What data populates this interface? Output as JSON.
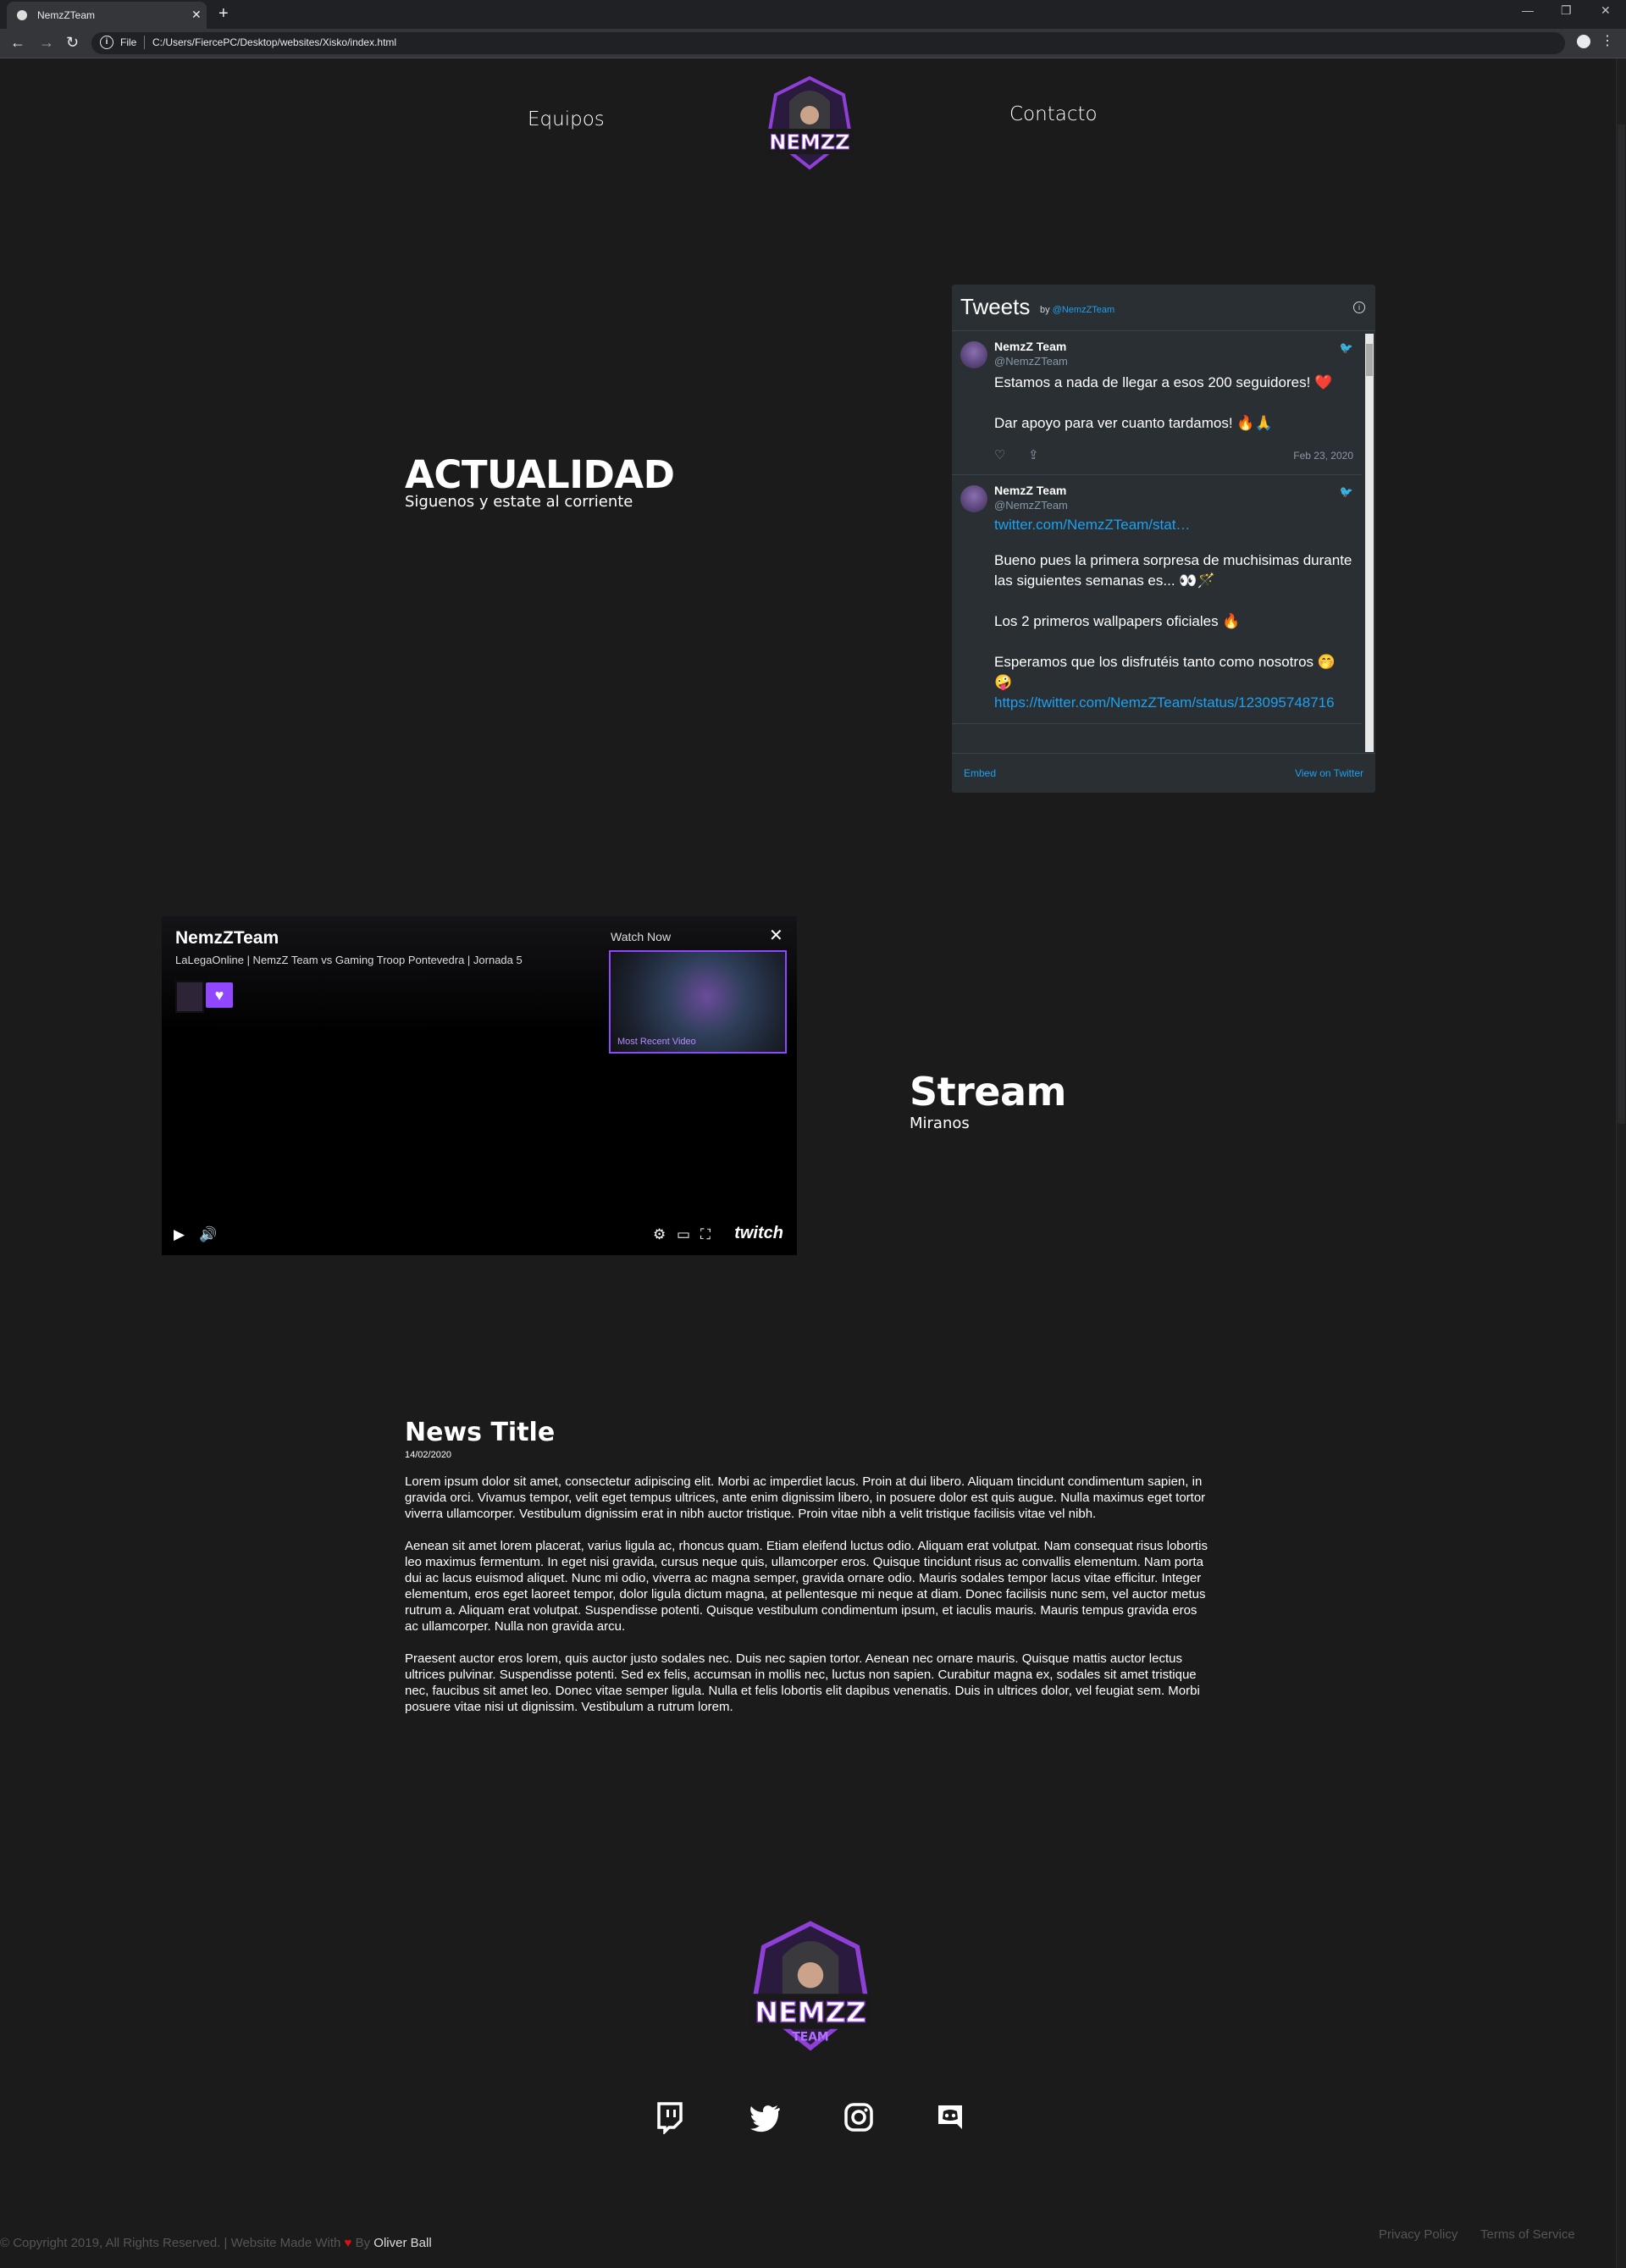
{
  "browser": {
    "tab_title": "NemzZTeam",
    "tab_close": "✕",
    "new_tab": "+",
    "scheme": "File",
    "url": "C:/Users/FiercePC/Desktop/websites/Xisko/index.html",
    "star": "☆",
    "back": "←",
    "forward": "→",
    "reload": "↻",
    "minimize": "—",
    "restore": "❐",
    "close": "✕",
    "menu": "⋮",
    "info": "i"
  },
  "nav": {
    "left_link": "Equipos",
    "right_link": "Contacto"
  },
  "logo": {
    "text": "NEMZZ",
    "sub": "TEAM"
  },
  "actualidad": {
    "title": "ACTUALIDAD",
    "subtitle": "Siguenos y estate al corriente"
  },
  "twitter_widget": {
    "title": "Tweets",
    "by_label": "by",
    "by_handle": "@NemzZTeam",
    "info": "i",
    "embed": "Embed",
    "view_on_twitter": "View on Twitter",
    "tweets": [
      {
        "name": "NemzZ Team",
        "handle": "@NemzZTeam",
        "text": "Estamos a nada de llegar a esos 200 seguidores! ❤️\n\nDar apoyo para ver cuanto tardamos! 🔥🙏",
        "date": "Feb 23, 2020"
      },
      {
        "name": "NemzZ Team",
        "handle": "@NemzZTeam",
        "link": "twitter.com/NemzZTeam/stat…",
        "text": "Bueno pues la primera sorpresa de muchisimas durante las siguientes semanas es... 👀🪄\n\nLos 2 primeros wallpapers oficiales 🔥\n\nEsperamos que los disfrutéis tanto como nosotros 🤭🤪",
        "link2": "https://twitter.com/NemzZTeam/status/123095748716"
      }
    ]
  },
  "stream": {
    "title": "Stream",
    "subtitle": "Miranos"
  },
  "player": {
    "channel": "NemzZTeam",
    "video_title": "LaLegaOnline | NemzZ Team vs Gaming Troop Pontevedra | Jornada 5",
    "watch_now": "Watch Now",
    "most_recent": "Most Recent Video",
    "close": "✕",
    "brand": "twitch",
    "follow_icon": "♥",
    "controls": {
      "play": "▶",
      "volume": "🔊",
      "settings": "⚙",
      "cast": "▭",
      "fullscreen": "⛶"
    }
  },
  "news": {
    "title": "News Title",
    "date": "14/02/2020",
    "paragraphs": [
      "Lorem ipsum dolor sit amet, consectetur adipiscing elit. Morbi ac imperdiet lacus. Proin at dui libero. Aliquam tincidunt condimentum sapien, in gravida orci. Vivamus tempor, velit eget tempus ultrices, ante enim dignissim libero, in posuere dolor est quis augue. Nulla maximus eget tortor viverra ullamcorper. Vestibulum dignissim erat in nibh auctor tristique. Proin vitae nibh a velit tristique facilisis vitae vel nibh.",
      "Aenean sit amet lorem placerat, varius ligula ac, rhoncus quam. Etiam eleifend luctus odio. Aliquam erat volutpat. Nam consequat risus lobortis leo maximus fermentum. In eget nisi gravida, cursus neque quis, ullamcorper eros. Quisque tincidunt risus ac convallis elementum. Nam porta dui ac lacus euismod aliquet. Nunc mi odio, viverra ac magna semper, gravida ornare odio. Mauris sodales tempor lacus vitae efficitur. Integer elementum, eros eget laoreet tempor, dolor ligula dictum magna, at pellentesque mi neque at diam. Donec facilisis nunc sem, vel auctor metus rutrum a. Aliquam erat volutpat. Suspendisse potenti. Quisque vestibulum condimentum ipsum, et iaculis mauris. Mauris tempus gravida eros ac ullamcorper. Nulla non gravida arcu.",
      "Praesent auctor eros lorem, quis auctor justo sodales nec. Duis nec sapien tortor. Aenean nec ornare mauris. Quisque mattis auctor lectus ultrices pulvinar. Suspendisse potenti. Sed ex felis, accumsan in mollis nec, luctus non sapien. Curabitur magna ex, sodales sit amet tristique nec, faucibus sit amet leo. Donec vitae semper ligula. Nulla et felis lobortis elit dapibus venenatis. Duis in ultrices dolor, vel feugiat sem. Morbi posuere vitae nisi ut dignissim. Vestibulum a rutrum lorem."
    ]
  },
  "footer": {
    "copyright_prefix": "© Copyright 2019, All Rights Reserved. | Website Made With",
    "heart": "♥",
    "by": "By",
    "author": "Oliver Ball",
    "privacy": "Privacy Policy",
    "terms": "Terms of Service",
    "social": [
      "twitch-icon",
      "twitter-icon",
      "instagram-icon",
      "discord-icon"
    ]
  },
  "colors": {
    "background": "#1b1b1c",
    "twitch_purple": "#9147ff",
    "twitter_blue": "#1da1f2",
    "widget_bg": "#292f33"
  }
}
